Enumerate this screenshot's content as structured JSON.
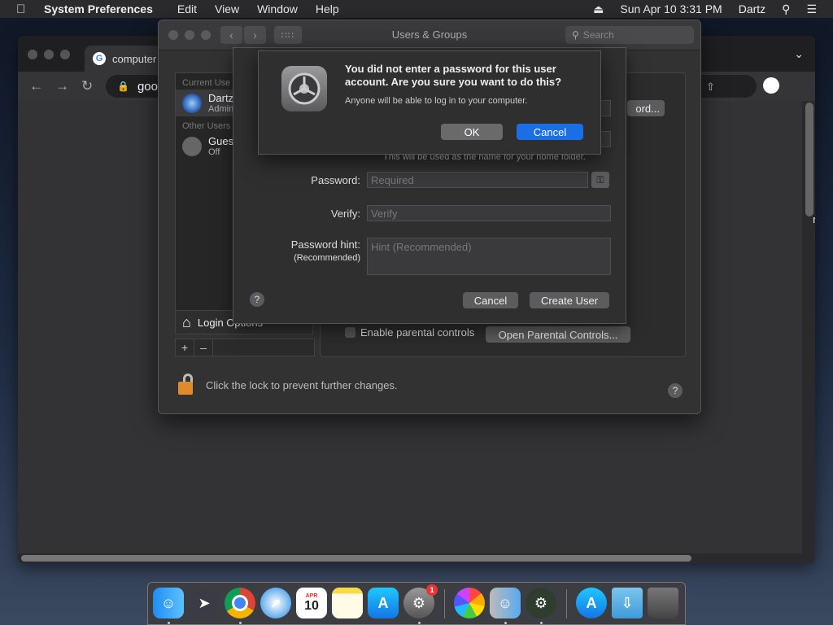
{
  "menubar": {
    "app_name": "System Preferences",
    "menus": [
      "Edit",
      "View",
      "Window",
      "Help"
    ],
    "date_time": "Sun Apr 10  3:31 PM",
    "user": "Dartz"
  },
  "chrome": {
    "tab_title": "computer",
    "address": "goog"
  },
  "syspref": {
    "window_title": "Users & Groups",
    "search_placeholder": "Search",
    "sections": {
      "current": "Current Use",
      "other": "Other Users"
    },
    "users": [
      {
        "name": "Dartz",
        "role": "Admin"
      },
      {
        "name": "Gues",
        "role": "Off"
      }
    ],
    "login_options_label": "Login Options",
    "parental_controls_label": "Enable parental controls",
    "open_parental_label": "Open Parental Controls...",
    "password_button_peek": "ord...",
    "lock_message": "Click the lock to prevent further changes."
  },
  "sheet": {
    "home_folder_note": "This will be used as the name for your home folder.",
    "password_label": "Password:",
    "password_placeholder": "Required",
    "verify_label": "Verify:",
    "verify_placeholder": "Verify",
    "hint_label": "Password hint:",
    "hint_sublabel": "(Recommended)",
    "hint_placeholder": "Hint (Recommended)",
    "cancel_label": "Cancel",
    "create_label": "Create User"
  },
  "alert": {
    "title": "You did not enter a password for this user account. Are you sure you want to do this?",
    "message": "Anyone will be able to log in to your computer.",
    "ok_label": "OK",
    "cancel_label": "Cancel"
  },
  "dock": {
    "calendar_month": "APR",
    "calendar_day": "10",
    "settings_badge": "1"
  },
  "colors": {
    "accent_blue": "#1a6ee6",
    "lock_orange": "#e08a2c"
  }
}
